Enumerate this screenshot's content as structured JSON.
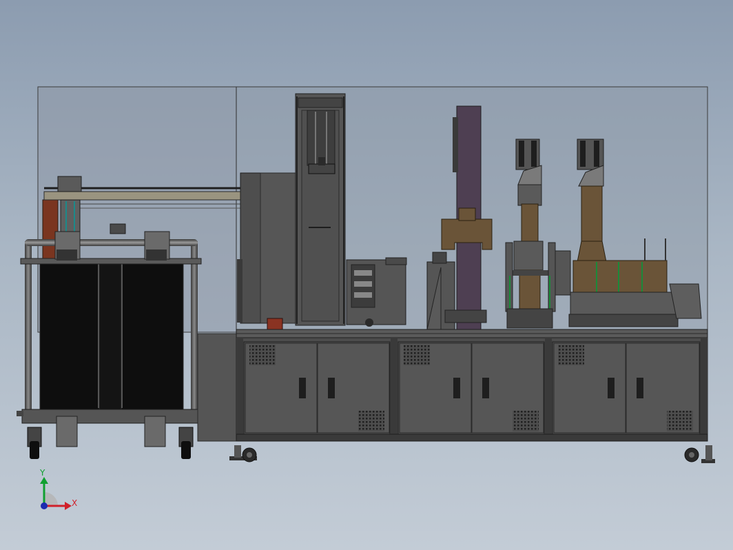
{
  "triad": {
    "x_label": "X",
    "y_label": "Y",
    "x_color": "#d0202a",
    "y_color": "#10a030",
    "z_color": "#1d2bb0"
  },
  "colors": {
    "background_top": "#8c9cb0",
    "background_bottom": "#c3ccd6",
    "machine_gray": "#4a4a4a",
    "machine_dark": "#2a2a2a",
    "enclosure_glass": "#8e98a6",
    "rust_panel": "#7a3520",
    "bronze_part": "#6a5438",
    "purple_column": "#4e3f52",
    "green_accent": "#1b8a3a"
  },
  "cabinets": {
    "count": 3,
    "doors_per_cabinet": 2
  }
}
